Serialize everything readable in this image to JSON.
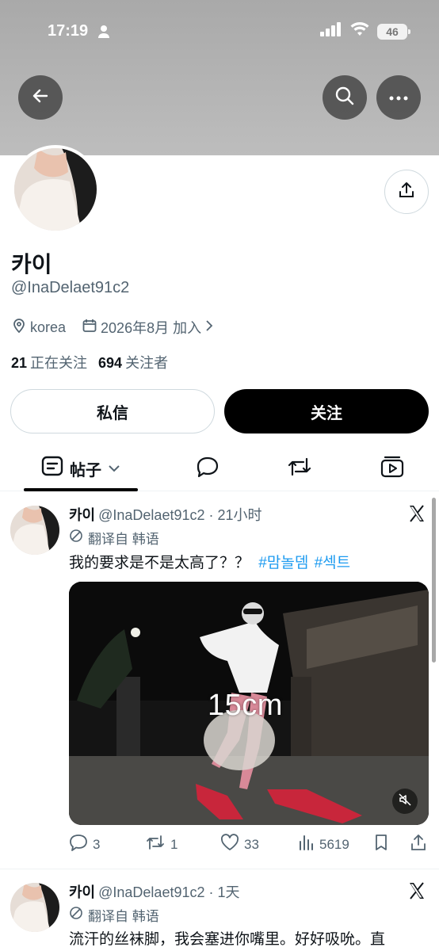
{
  "status_bar": {
    "time": "17:19",
    "battery": "46"
  },
  "profile": {
    "name": "카이",
    "handle": "@InaDelaet91c2",
    "location": "korea",
    "joined": "2026年8月 加入",
    "following_count": "21",
    "following_label": "正在关注",
    "followers_count": "694",
    "followers_label": "关注者",
    "dm_label": "私信",
    "follow_label": "关注"
  },
  "tabs": {
    "posts_label": "帖子"
  },
  "tweets": [
    {
      "name": "카이",
      "meta": "@InaDelaet91c2 · 21小时",
      "translate": "翻译自 韩语",
      "text": "我的要求是不是太高了？？",
      "hashtags": [
        "#맘놀뎀",
        "#섹트"
      ],
      "overlay": "15cm",
      "replies": "3",
      "retweets": "1",
      "likes": "33",
      "views": "5619"
    },
    {
      "name": "카이",
      "meta": "@InaDelaet91c2 · 1天",
      "translate": "翻译自 韩语",
      "text": "流汗的丝袜脚，我会塞进你嘴里。好好吸吮。直"
    }
  ],
  "icons": [
    "back-arrow-icon",
    "search-icon",
    "more-icon",
    "share-icon",
    "location-icon",
    "calendar-icon",
    "posts-icon",
    "chevron-down-icon",
    "replies-icon",
    "retweet-icon",
    "media-icon",
    "x-logo-icon",
    "translate-icon",
    "reply-icon",
    "like-icon",
    "views-icon",
    "bookmark-icon",
    "mute-icon"
  ]
}
